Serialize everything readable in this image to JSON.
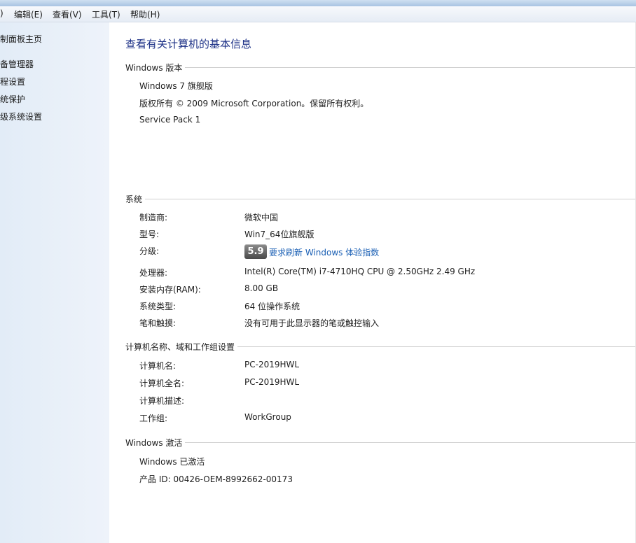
{
  "menu": {
    "file_fragment": ")",
    "edit": "编辑(E)",
    "view": "查看(V)",
    "tools": "工具(T)",
    "help": "帮助(H)"
  },
  "sidebar": {
    "items": [
      {
        "label": "制面板主页"
      },
      {
        "label": "备管理器"
      },
      {
        "label": "程设置"
      },
      {
        "label": "统保护"
      },
      {
        "label": "级系统设置"
      }
    ]
  },
  "main": {
    "title": "查看有关计算机的基本信息",
    "edition": {
      "header": "Windows 版本",
      "name": "Windows 7 旗舰版",
      "copyright": "版权所有 © 2009 Microsoft Corporation。保留所有权利。",
      "service_pack": "Service Pack 1"
    },
    "system": {
      "header": "系统",
      "manufacturer_label": "制造商:",
      "manufacturer_value": "微软中国",
      "model_label": "型号:",
      "model_value": "Win7_64位旗舰版",
      "rating_label": "分级:",
      "rating_score": "5.9",
      "rating_link": "要求刷新 Windows 体验指数",
      "processor_label": "处理器:",
      "processor_value": "Intel(R) Core(TM) i7-4710HQ CPU @ 2.50GHz   2.49 GHz",
      "ram_label": "安装内存(RAM):",
      "ram_value": "8.00 GB",
      "type_label": "系统类型:",
      "type_value": "64 位操作系统",
      "pen_label": "笔和触摸:",
      "pen_value": "没有可用于此显示器的笔或触控输入"
    },
    "computer": {
      "header": "计算机名称、域和工作组设置",
      "name_label": "计算机名:",
      "name_value": "PC-2019HWL",
      "fullname_label": "计算机全名:",
      "fullname_value": "PC-2019HWL",
      "desc_label": "计算机描述:",
      "workgroup_label": "工作组:",
      "workgroup_value": "WorkGroup"
    },
    "activation": {
      "header": "Windows 激活",
      "status": "Windows 已激活",
      "product_id": "产品 ID: 00426-OEM-8992662-00173"
    }
  },
  "colors": {
    "title": "#1e3287",
    "link": "#1a5fb4",
    "sidebar_bg": "#e2ecf7"
  }
}
